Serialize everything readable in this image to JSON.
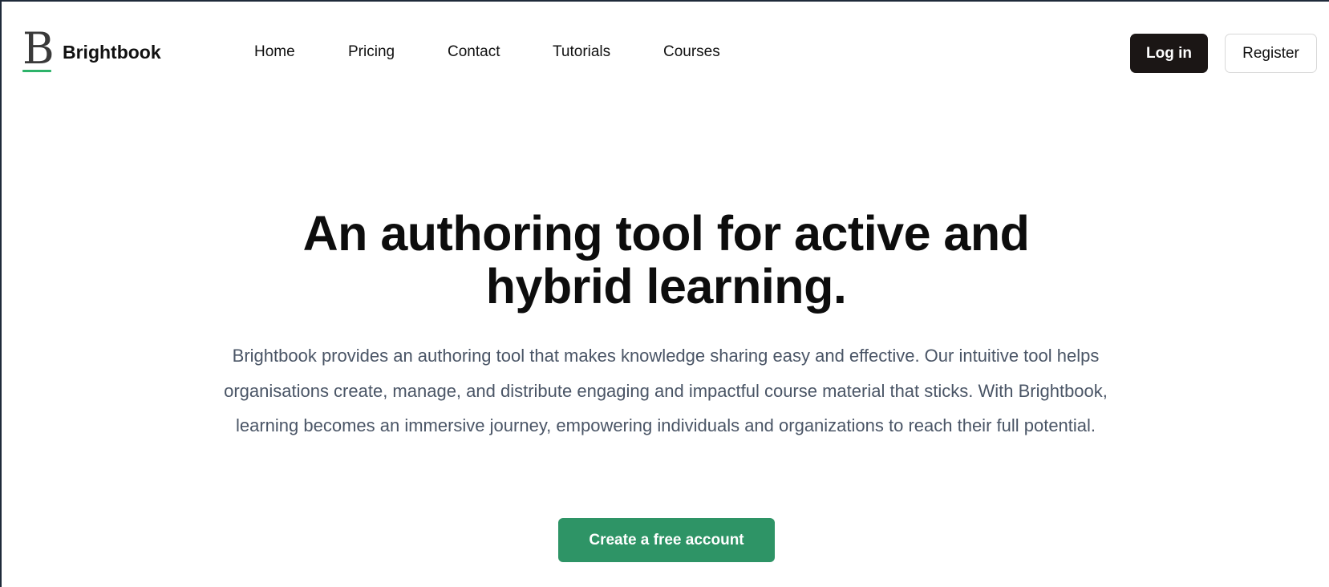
{
  "brand": {
    "logo_letter": "B",
    "name": "Brightbook",
    "accent_color": "#2db36a"
  },
  "nav": {
    "items": [
      {
        "label": "Home"
      },
      {
        "label": "Pricing"
      },
      {
        "label": "Contact"
      },
      {
        "label": "Tutorials"
      },
      {
        "label": "Courses"
      }
    ]
  },
  "auth": {
    "login_label": "Log in",
    "register_label": "Register"
  },
  "hero": {
    "title_line1": "An authoring tool for active and",
    "title_line2": "hybrid learning.",
    "description": "Brightbook provides an authoring tool that makes knowledge sharing easy and effective. Our intuitive tool helps organisations create, manage, and distribute engaging and impactful course material that sticks. With Brightbook, learning becomes an immersive journey, empowering individuals and organizations to reach their full potential.",
    "cta_label": "Create a free account",
    "cta_color": "#2e9466"
  }
}
